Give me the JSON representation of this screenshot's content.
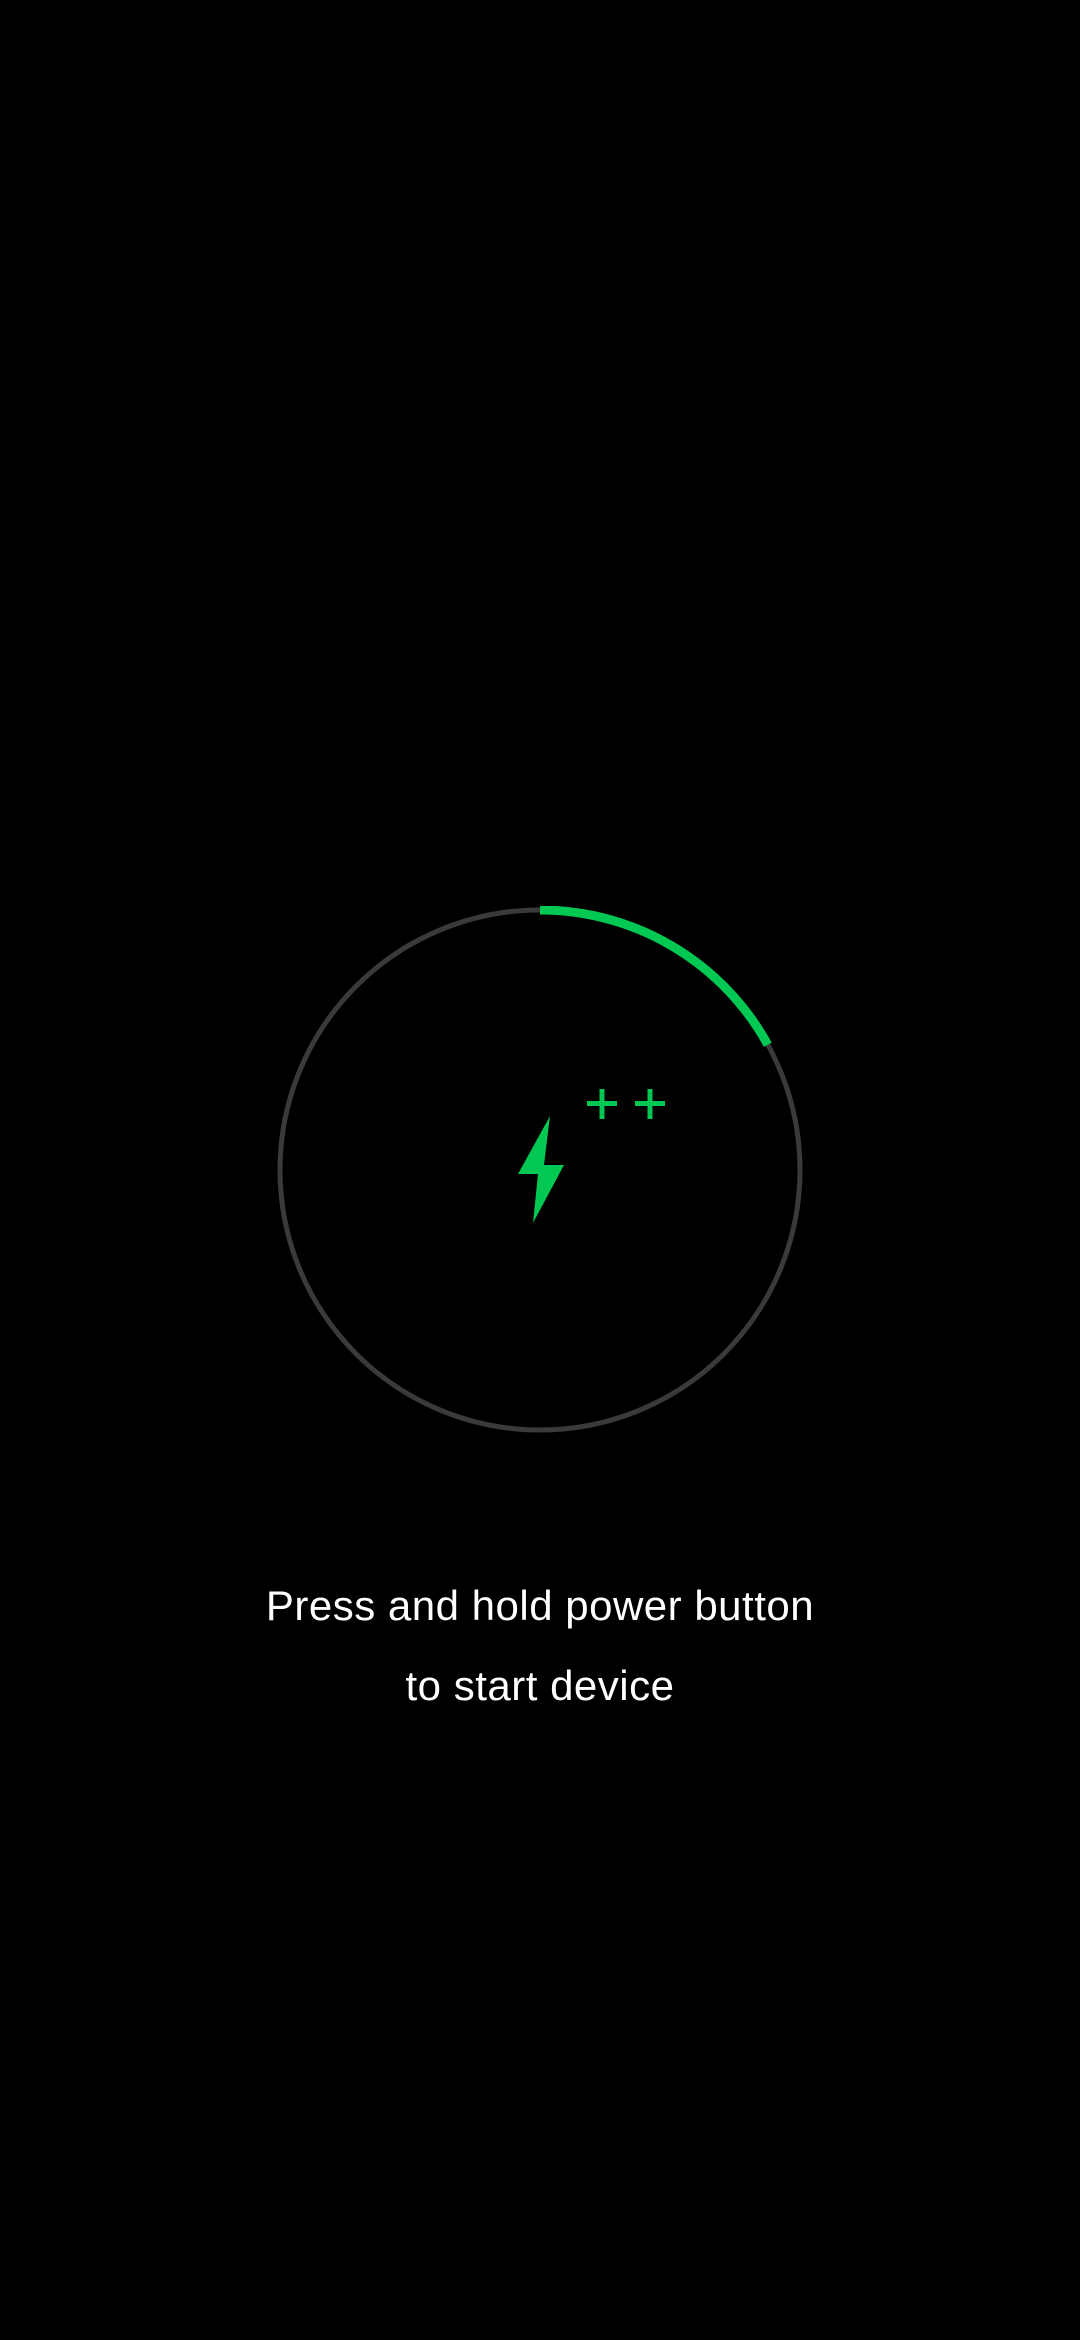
{
  "colors": {
    "background": "#000000",
    "ring_track": "#3a3a3a",
    "accent_green": "#00c853",
    "text": "#ffffff"
  },
  "charge": {
    "progress_fraction": 0.17,
    "icon": "lightning-bolt-icon",
    "indicator_icons": [
      "plus-icon",
      "plus-icon"
    ]
  },
  "message": {
    "line1": "Press and hold power button",
    "line2": "to start device"
  }
}
